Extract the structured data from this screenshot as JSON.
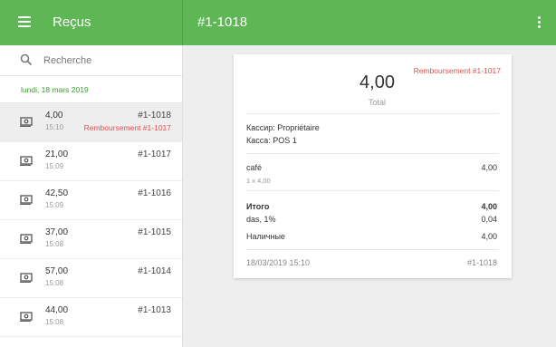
{
  "app": {
    "title": "Reçus"
  },
  "header": {
    "receipt_number": "#1-1018"
  },
  "search": {
    "placeholder": "Recherche"
  },
  "list": {
    "date": "lundi, 18 mars 2019",
    "items": [
      {
        "amount": "4,00",
        "time": "15:10",
        "number": "#1-1018",
        "refund": "Remboursement #1-1017",
        "selected": true
      },
      {
        "amount": "21,00",
        "time": "15:09",
        "number": "#1-1017",
        "refund": ""
      },
      {
        "amount": "42,50",
        "time": "15:09",
        "number": "#1-1016",
        "refund": ""
      },
      {
        "amount": "37,00",
        "time": "15:08",
        "number": "#1-1015",
        "refund": ""
      },
      {
        "amount": "57,00",
        "time": "15:08",
        "number": "#1-1014",
        "refund": ""
      },
      {
        "amount": "44,00",
        "time": "15:08",
        "number": "#1-1013",
        "refund": ""
      }
    ]
  },
  "receipt": {
    "refund_link": "Remboursement #1-1017",
    "total_amount": "4,00",
    "total_label": "Total",
    "cashier": "Кассир: Propriétaire",
    "pos": "Касса: POS 1",
    "line_name": "café",
    "line_qty": "1 x 4,00",
    "line_amount": "4,00",
    "subtotal_label": "Итого",
    "subtotal_value": "4,00",
    "tax_label": "das, 1%",
    "tax_value": "0,04",
    "payment_label": "Наличные",
    "payment_value": "4,00",
    "datetime": "18/03/2019 15:10",
    "number": "#1-1018"
  },
  "colors": {
    "accent": "#5fb655",
    "refund": "#e05050",
    "date": "#3a9d30"
  }
}
